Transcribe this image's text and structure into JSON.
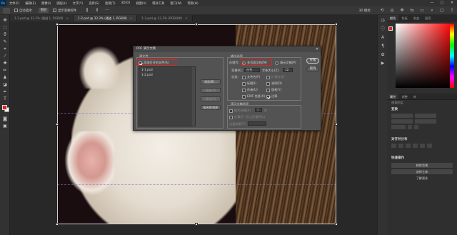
{
  "menubar": {
    "logo": "Ps",
    "items": [
      "文件(F)",
      "编辑(E)",
      "图像(I)",
      "图层(L)",
      "文字(Y)",
      "选择(S)",
      "滤镜(T)",
      "3D(D)",
      "视图(V)",
      "增效工具",
      "窗口(W)",
      "帮助(H)"
    ],
    "win_buttons": [
      "—",
      "□",
      "✕"
    ]
  },
  "options": {
    "auto_select": "自动选择:",
    "layer_select": "图层",
    "show_transform": "显示变换控件",
    "mode_3d": "3D 模式:",
    "more": "···"
  },
  "tabs": [
    {
      "label": "1-1.psd @ 33.3% (通道 1, RGB/8)",
      "active": false
    },
    {
      "label": "1-2.psd @ 33.3% (通道 1, RGB/8)",
      "active": true
    },
    {
      "label": "1-3.psd @ 33.3% (RGB/8#)",
      "active": false
    }
  ],
  "tools": [
    "move-tool",
    "marquee-tool",
    "lasso-tool",
    "quick-select-tool",
    "crop-tool",
    "eyedropper-tool",
    "healing-tool",
    "brush-tool",
    "stamp-tool",
    "history-brush-tool",
    "eraser-tool",
    "gradient-tool",
    "blur-tool",
    "dodge-tool",
    "pen-tool",
    "type-tool",
    "path-select-tool",
    "shape-tool",
    "hand-tool",
    "zoom-tool"
  ],
  "colors": {
    "foreground": "#e1261c",
    "background": "#ffffff",
    "highlight": "#e0241b"
  },
  "right_panel": {
    "tabs": [
      "颜色",
      "色板",
      "渐变",
      "图案"
    ],
    "properties_tabs": [
      "属性",
      "调整",
      "库"
    ],
    "layer_label": "像素图层",
    "transform_title": "变换",
    "align_title": "对齐并分布",
    "quick_actions_title": "快速操作",
    "btn_remove_bg": "移除背景",
    "btn_select_subject": "选择主体",
    "btn_more": "了解更多"
  },
  "dialog": {
    "title": "PDF 演示文稿",
    "source_files": "源文件",
    "add_open_files": "添加打开的文件(A)",
    "files": [
      "1-1.psd",
      "1-2.psd"
    ],
    "btn_browse": "浏览(B)...",
    "btn_duplicate": "复制(D)",
    "btn_remove": "移去(R)",
    "btn_sort": "按名称排序",
    "output_options": "输出选项",
    "save_as": "存储为:",
    "multi_page": "多页面文档(M)",
    "presentation": "演示文稿(P)",
    "background": "背景(K):",
    "background_value": "白色",
    "font_size": "字体大小(Z):",
    "font_size_value": "12",
    "include": "包括:",
    "filename": "文件名(F)",
    "extension": "扩展名(E)",
    "title_chk": "标题(I)",
    "description": "说明(D)",
    "author": "作者(U)",
    "copyright": "版权(Y)",
    "exif": "EXIF 信息(X)",
    "notes": "注释",
    "slideshow_options": "演示文稿选项",
    "advance_every": "换片间隔(A)",
    "advance_value": "5",
    "seconds": "秒",
    "loop": "在最后一页之后循环(L)",
    "transition": "过渡效果(T):",
    "btn_save": "存储",
    "btn_cancel": "取消"
  }
}
